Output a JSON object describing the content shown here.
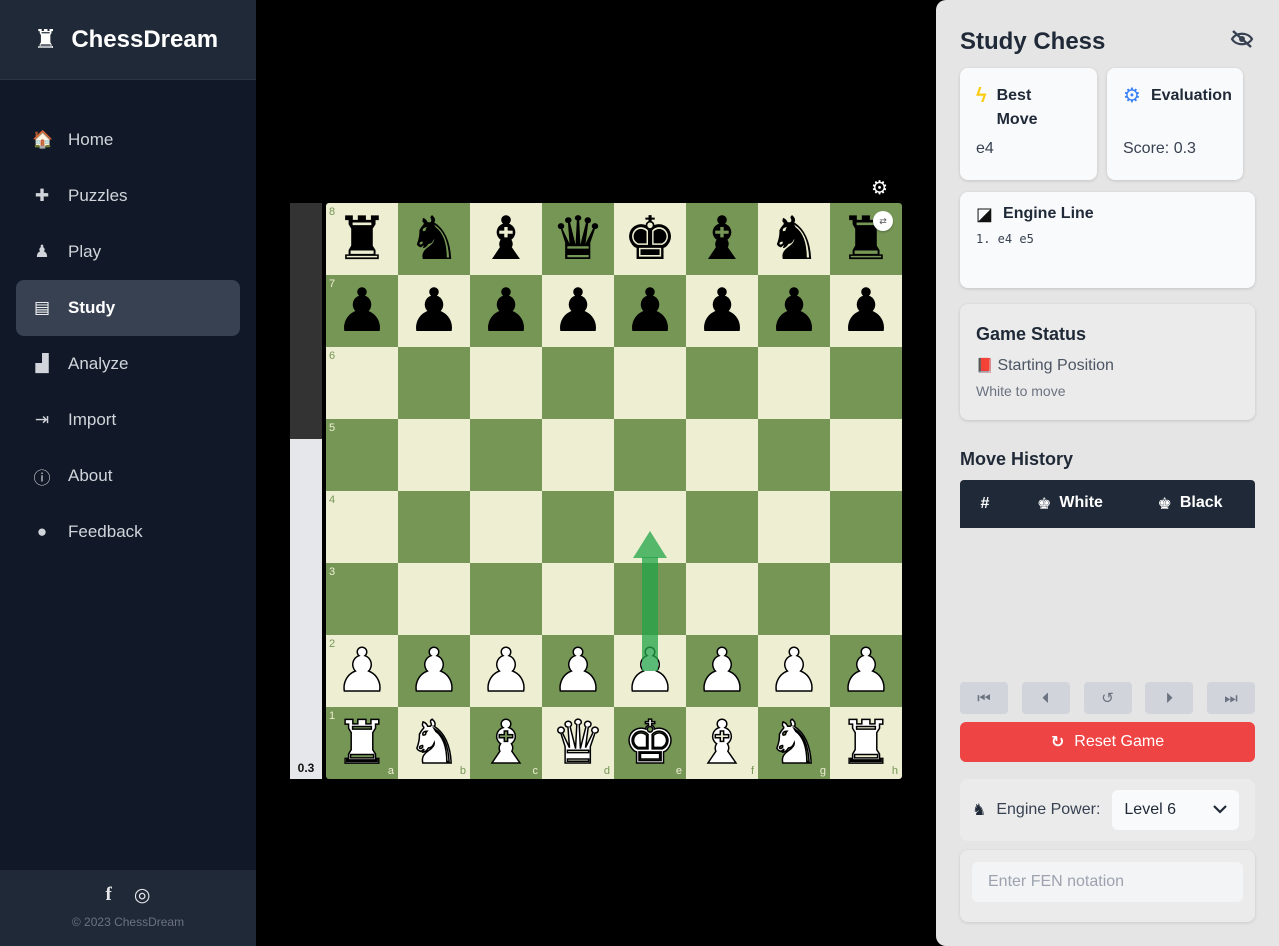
{
  "app": {
    "name": "ChessDream",
    "logo_icon": "♜"
  },
  "sidebar": {
    "items": [
      {
        "label": "Home",
        "icon": "🏠",
        "icon_name": "home-icon",
        "active": false
      },
      {
        "label": "Puzzles",
        "icon": "✚",
        "icon_name": "puzzle-icon",
        "active": false
      },
      {
        "label": "Play",
        "icon": "♟",
        "icon_name": "chess-pawn-icon",
        "active": false
      },
      {
        "label": "Study",
        "icon": "▤",
        "icon_name": "book-icon",
        "active": true
      },
      {
        "label": "Analyze",
        "icon": "▟",
        "icon_name": "chart-icon",
        "active": false
      },
      {
        "label": "Import",
        "icon": "⇥",
        "icon_name": "import-icon",
        "active": false
      },
      {
        "label": "About",
        "icon": "ⓘ",
        "icon_name": "info-icon",
        "active": false
      },
      {
        "label": "Feedback",
        "icon": "●",
        "icon_name": "comment-icon",
        "active": false
      }
    ],
    "footer": {
      "facebook": "f",
      "instagram": "◎",
      "copyright": "© 2023 ChessDream"
    }
  },
  "board": {
    "eval_label": "0.3",
    "eval_white_fraction": 0.59,
    "ranks": [
      [
        "♜",
        "♞",
        "♝",
        "♛",
        "♚",
        "♝",
        "♞",
        "♜"
      ],
      [
        "♟",
        "♟",
        "♟",
        "♟",
        "♟",
        "♟",
        "♟",
        "♟"
      ],
      [
        "",
        "",
        "",
        "",
        "",
        "",
        "",
        ""
      ],
      [
        "",
        "",
        "",
        "",
        "",
        "",
        "",
        ""
      ],
      [
        "",
        "",
        "",
        "",
        "",
        "",
        "",
        ""
      ],
      [
        "",
        "",
        "",
        "",
        "",
        "",
        "",
        ""
      ],
      [
        "♟",
        "♟",
        "♟",
        "♟",
        "♟",
        "♟",
        "♟",
        "♟"
      ],
      [
        "♜",
        "♞",
        "♝",
        "♛",
        "♚",
        "♝",
        "♞",
        "♜"
      ]
    ],
    "rank_labels": [
      "8",
      "7",
      "6",
      "5",
      "4",
      "3",
      "2",
      "1"
    ],
    "file_labels": [
      "a",
      "b",
      "c",
      "d",
      "e",
      "f",
      "g",
      "h"
    ],
    "arrow": {
      "from": "e2",
      "to": "e4",
      "color": "#22a447"
    },
    "flip_icon": "⇄",
    "settings_icon": "⚙"
  },
  "panel": {
    "title": "Study Chess",
    "best_move": {
      "label": "Best Move",
      "value": "e4",
      "icon": "ϟ"
    },
    "evaluation": {
      "label": "Evaluation",
      "value": "Score: 0.3",
      "icon": "⚙"
    },
    "engine_line": {
      "label": "Engine Line",
      "value": "1. e4 e5",
      "icon": "◪"
    },
    "game_status": {
      "title": "Game Status",
      "status": "Starting Position",
      "status_icon": "📕",
      "sub": "White to move"
    },
    "move_history": {
      "title": "Move History",
      "col_num": "#",
      "col_white": "White",
      "col_black": "Black",
      "white_icon": "♚",
      "black_icon": "♚"
    },
    "controls": [
      "⏮",
      "⏴",
      "↺",
      "⏵",
      "⏭"
    ],
    "reset": {
      "label": "Reset Game",
      "icon": "↻"
    },
    "engine_power": {
      "label": "Engine Power:",
      "value": "Level 6",
      "icon": "♞"
    },
    "fen": {
      "placeholder": "Enter FEN notation",
      "value": ""
    }
  }
}
